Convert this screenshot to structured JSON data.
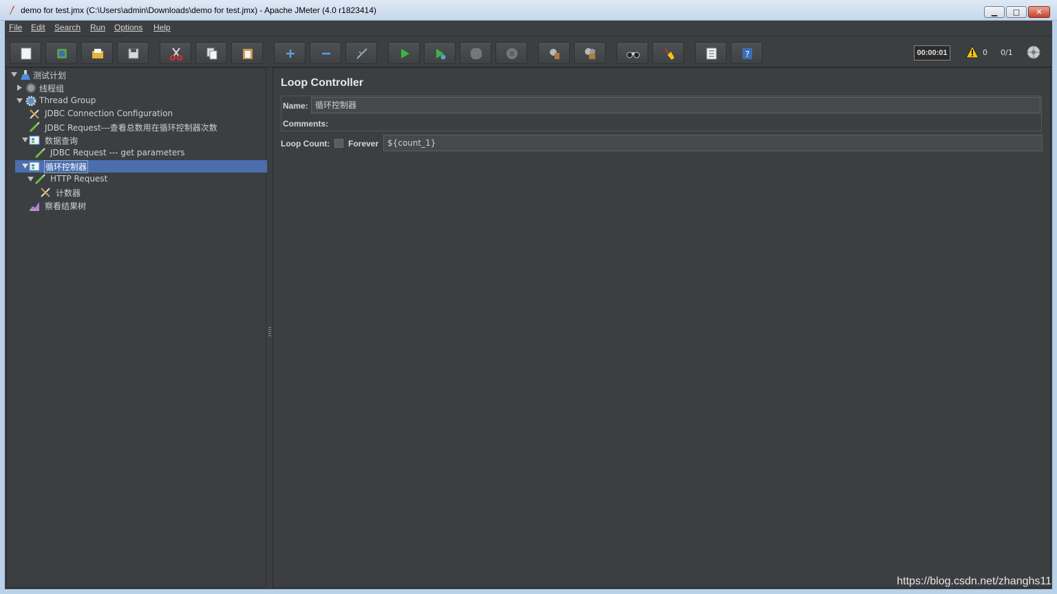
{
  "window": {
    "title": "demo for test.jmx (C:\\Users\\admin\\Downloads\\demo for test.jmx) - Apache JMeter (4.0 r1823414)",
    "minimize": "▁",
    "maximize": "□",
    "close": "✕"
  },
  "menu": [
    "File",
    "Edit",
    "Search",
    "Run",
    "Options",
    "Help"
  ],
  "toolbar": {
    "buttons": [
      "new",
      "templates",
      "open",
      "save",
      "cut",
      "copy",
      "paste",
      "expand",
      "collapse",
      "toggle",
      "start",
      "start-no-pauses",
      "stop",
      "shutdown",
      "clear",
      "clear-all",
      "search",
      "reset-search",
      "function-helper",
      "help"
    ],
    "timer": "00:00:01",
    "warning_count": "0",
    "threads": "0/1"
  },
  "tree": [
    {
      "label": "测试计划",
      "icon": "flask-icon",
      "toggle": "down"
    },
    {
      "label": "线程组",
      "icon": "gear-icon",
      "toggle": "right"
    },
    {
      "label": "Thread Group",
      "icon": "gear-icon",
      "toggle": "down"
    },
    {
      "label": "JDBC Connection Configuration",
      "icon": "wrench-icon"
    },
    {
      "label": "JDBC Request---查看总数用在循环控制器次数",
      "icon": "pipette-icon"
    },
    {
      "label": "数据查询",
      "icon": "controller-icon",
      "toggle": "down"
    },
    {
      "label": "JDBC Request --- get parameters",
      "icon": "pipette-icon"
    },
    {
      "label": "循环控制器",
      "icon": "controller-icon",
      "toggle": "down",
      "selected": true
    },
    {
      "label": "HTTP Request",
      "icon": "pipette-icon",
      "toggle": "down"
    },
    {
      "label": "计数器",
      "icon": "wrench-icon"
    },
    {
      "label": "察看结果树",
      "icon": "chart-icon"
    }
  ],
  "panel": {
    "title": "Loop Controller",
    "name_label": "Name:",
    "name_value": "循环控制器",
    "comments_label": "Comments:",
    "loop_count_label": "Loop Count:",
    "forever_label": "Forever",
    "forever_checked": false,
    "loop_count_value": "${count_1}"
  },
  "watermark": "https://blog.csdn.net/zhanghs11",
  "colors": {
    "accent": "#4b6eaf",
    "background": "#3c3f41"
  }
}
